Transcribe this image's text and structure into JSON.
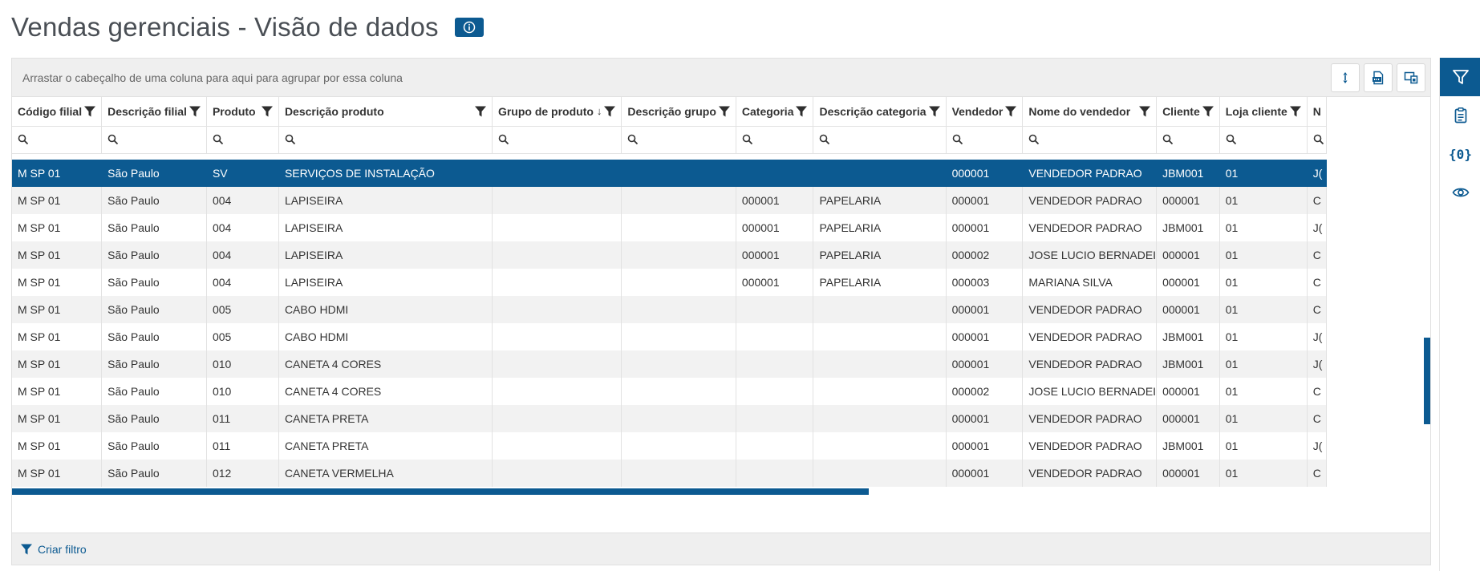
{
  "page": {
    "title": "Vendas gerenciais - Visão de dados",
    "info_icon": "info-icon"
  },
  "grid": {
    "group_bar_text": "Arrastar o cabeçalho de uma coluna para aqui para agrupar por essa coluna",
    "toolbar": [
      {
        "name": "expand-rows-icon"
      },
      {
        "name": "export-csv-icon"
      },
      {
        "name": "column-chooser-icon"
      }
    ],
    "columns": [
      {
        "label": "Código filial",
        "sort": ""
      },
      {
        "label": "Descrição filial",
        "sort": ""
      },
      {
        "label": "Produto",
        "sort": ""
      },
      {
        "label": "Descrição produto",
        "sort": ""
      },
      {
        "label": "Grupo de produto",
        "sort": "↓"
      },
      {
        "label": "Descrição grupo",
        "sort": ""
      },
      {
        "label": "Categoria",
        "sort": ""
      },
      {
        "label": "Descrição categoria",
        "sort": ""
      },
      {
        "label": "Vendedor",
        "sort": ""
      },
      {
        "label": "Nome do vendedor",
        "sort": ""
      },
      {
        "label": "Cliente",
        "sort": ""
      },
      {
        "label": "Loja cliente",
        "sort": ""
      },
      {
        "label": "N",
        "sort": ""
      }
    ],
    "rows": [
      [
        "M SP 01",
        "São Paulo",
        "SV",
        "SERVIÇOS DE INSTALAÇÃO",
        "",
        "",
        "",
        "",
        "000001",
        "VENDEDOR PADRAO",
        "JBM001",
        "01",
        "J("
      ],
      [
        "M SP 01",
        "São Paulo",
        "004",
        "LAPISEIRA",
        "",
        "",
        "000001",
        "PAPELARIA",
        "000001",
        "VENDEDOR PADRAO",
        "000001",
        "01",
        "C"
      ],
      [
        "M SP 01",
        "São Paulo",
        "004",
        "LAPISEIRA",
        "",
        "",
        "000001",
        "PAPELARIA",
        "000001",
        "VENDEDOR PADRAO",
        "JBM001",
        "01",
        "J("
      ],
      [
        "M SP 01",
        "São Paulo",
        "004",
        "LAPISEIRA",
        "",
        "",
        "000001",
        "PAPELARIA",
        "000002",
        "JOSE LUCIO BERNADEI",
        "000001",
        "01",
        "C"
      ],
      [
        "M SP 01",
        "São Paulo",
        "004",
        "LAPISEIRA",
        "",
        "",
        "000001",
        "PAPELARIA",
        "000003",
        "MARIANA SILVA",
        "000001",
        "01",
        "C"
      ],
      [
        "M SP 01",
        "São Paulo",
        "005",
        "CABO HDMI",
        "",
        "",
        "",
        "",
        "000001",
        "VENDEDOR PADRAO",
        "000001",
        "01",
        "C"
      ],
      [
        "M SP 01",
        "São Paulo",
        "005",
        "CABO HDMI",
        "",
        "",
        "",
        "",
        "000001",
        "VENDEDOR PADRAO",
        "JBM001",
        "01",
        "J("
      ],
      [
        "M SP 01",
        "São Paulo",
        "010",
        "CANETA 4 CORES",
        "",
        "",
        "",
        "",
        "000001",
        "VENDEDOR PADRAO",
        "JBM001",
        "01",
        "J("
      ],
      [
        "M SP 01",
        "São Paulo",
        "010",
        "CANETA 4 CORES",
        "",
        "",
        "",
        "",
        "000002",
        "JOSE LUCIO BERNADEI",
        "000001",
        "01",
        "C"
      ],
      [
        "M SP 01",
        "São Paulo",
        "011",
        "CANETA PRETA",
        "",
        "",
        "",
        "",
        "000001",
        "VENDEDOR PADRAO",
        "000001",
        "01",
        "C"
      ],
      [
        "M SP 01",
        "São Paulo",
        "011",
        "CANETA PRETA",
        "",
        "",
        "",
        "",
        "000001",
        "VENDEDOR PADRAO",
        "JBM001",
        "01",
        "J("
      ],
      [
        "M SP 01",
        "São Paulo",
        "012",
        "CANETA VERMELHA",
        "",
        "",
        "",
        "",
        "000001",
        "VENDEDOR PADRAO",
        "000001",
        "01",
        "C"
      ]
    ],
    "selected_row": 0,
    "create_filter_label": "Criar filtro"
  },
  "side_rail": [
    {
      "name": "filter-icon",
      "active": true
    },
    {
      "name": "clipboard-icon",
      "active": false
    },
    {
      "name": "variables-icon",
      "text": "{0}",
      "active": false
    },
    {
      "name": "eye-icon",
      "active": false
    }
  ],
  "colors": {
    "accent": "#0c5a91",
    "row_alt": "#f2f2f2",
    "bar_bg": "#efefef"
  }
}
